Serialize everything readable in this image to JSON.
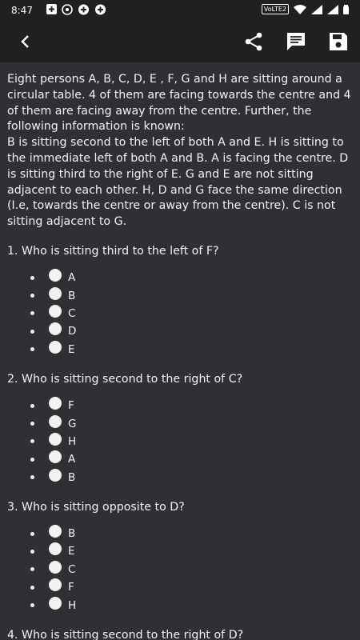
{
  "status": {
    "time": "8:47",
    "network_label": "VoLTE2"
  },
  "passage": [
    "Eight persons A, B, C, D, E , F, G and H are sitting around a circular table. 4 of them are facing towards the centre and 4 of them are facing away from the centre. Further, the following information is known:",
    "B is sitting second to the left of both A and E. H is sitting to the immediate left of both A and B. A is facing the centre. D is sitting third to the right of E. G and E are not sitting adjacent to each other. H, D and G face the same direction (I.e, towards the centre or away from the centre). C is not sitting adjacent to G."
  ],
  "questions": [
    {
      "text": "1. Who is sitting third to the left of F?",
      "options": [
        "A",
        "B",
        "C",
        "D",
        "E"
      ]
    },
    {
      "text": "2. Who is sitting second to the right of C?",
      "options": [
        "F",
        "G",
        "H",
        "A",
        "B"
      ]
    },
    {
      "text": "3. Who is sitting opposite to D?",
      "options": [
        "B",
        "E",
        "C",
        "F",
        "H"
      ]
    },
    {
      "text": "4. Who is sitting second to the right of D?",
      "options": []
    }
  ]
}
